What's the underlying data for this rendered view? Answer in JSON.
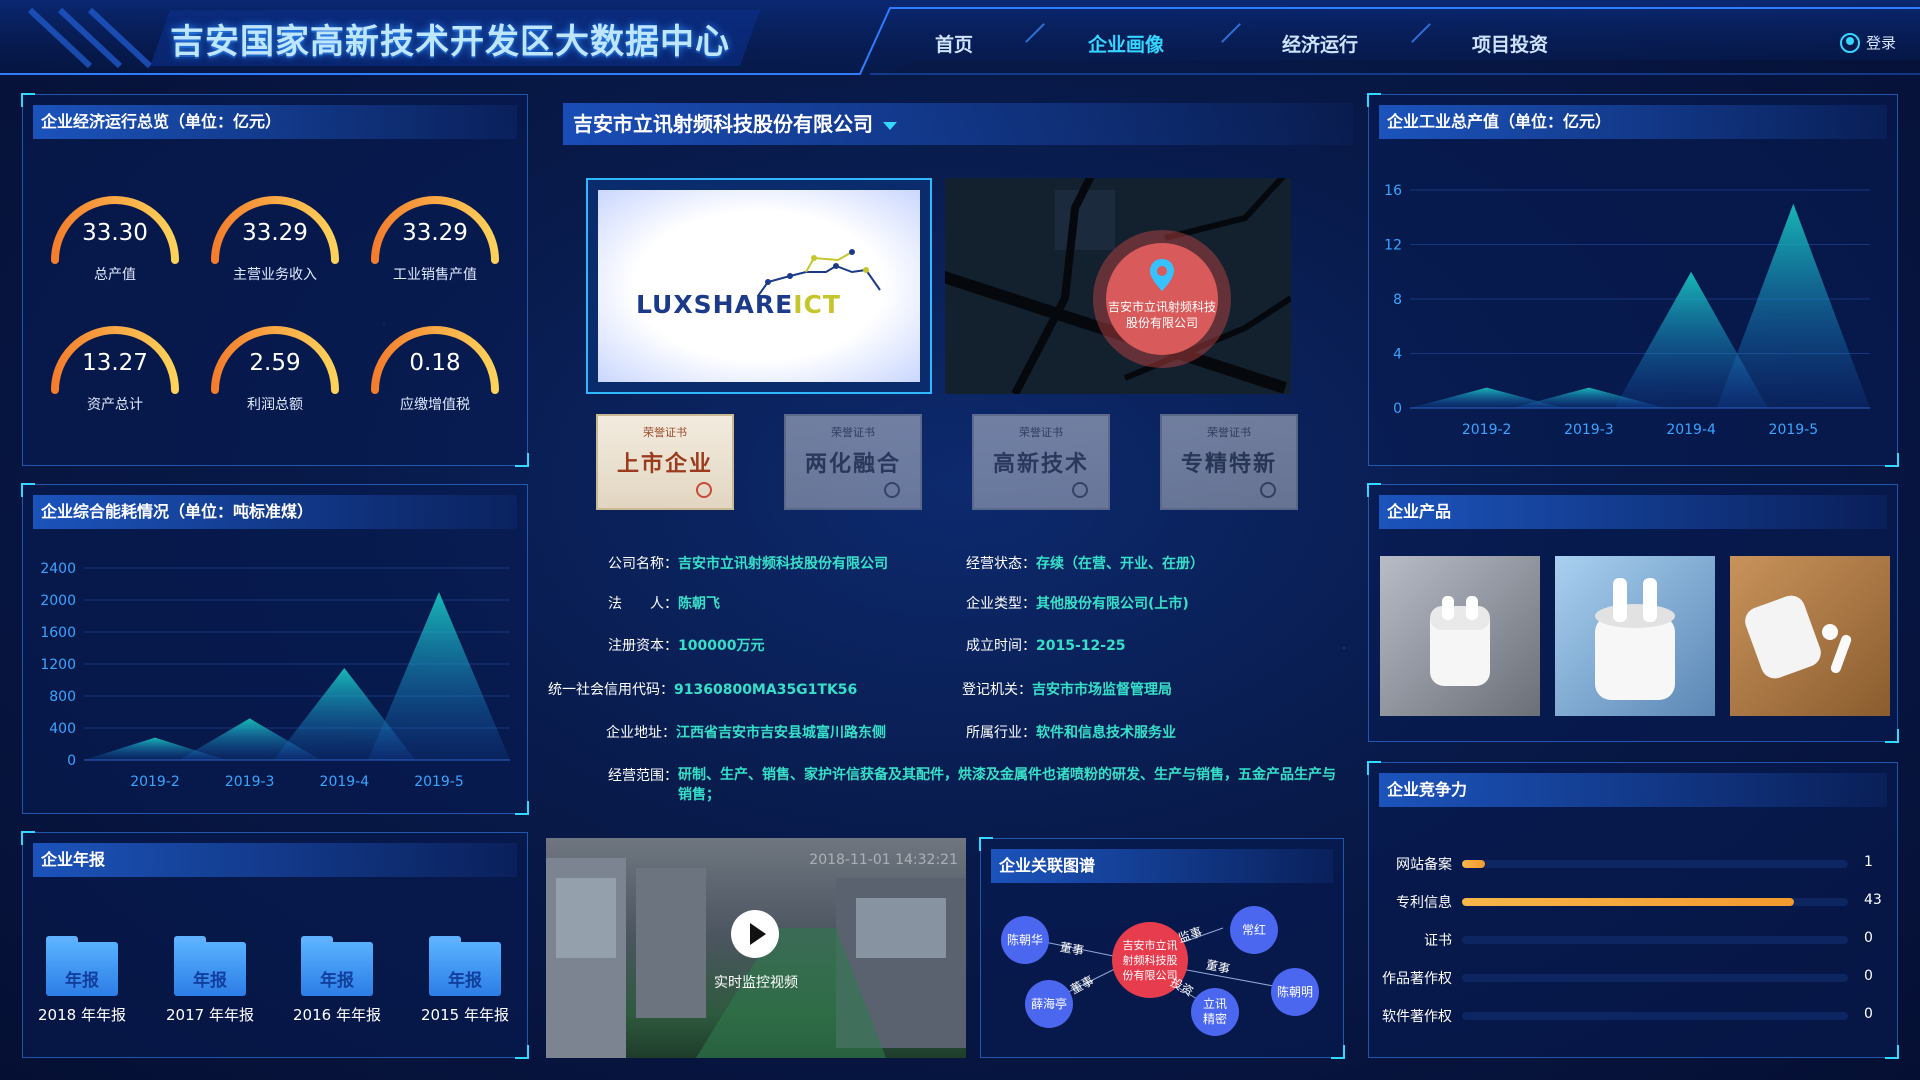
{
  "header": {
    "title": "吉安国家高新技术开发区大数据中心",
    "nav": [
      {
        "label": "首页",
        "active": false
      },
      {
        "label": "企业画像",
        "active": true
      },
      {
        "label": "经济运行",
        "active": false
      },
      {
        "label": "项目投资",
        "active": false
      }
    ],
    "login_label": "登录"
  },
  "overview": {
    "title": "企业经济运行总览（单位：亿元）",
    "gauges": [
      {
        "value": "33.30",
        "label": "总产值"
      },
      {
        "value": "33.29",
        "label": "主营业务收入"
      },
      {
        "value": "33.29",
        "label": "工业销售产值"
      },
      {
        "value": "13.27",
        "label": "资产总计"
      },
      {
        "value": "2.59",
        "label": "利润总额"
      },
      {
        "value": "0.18",
        "label": "应缴增值税"
      }
    ]
  },
  "energy": {
    "title": "企业综合能耗情况（单位：吨标准煤）"
  },
  "annual": {
    "title": "企业年报",
    "folder_label": "年报",
    "items": [
      "2018 年年报",
      "2017 年年报",
      "2016 年年报",
      "2015 年年报"
    ]
  },
  "company": {
    "selected": "吉安市立讯射频科技股份有限公司",
    "logo_text_a": "LUXSHARE",
    "logo_text_b": "ICT",
    "map_label": "吉安市立讯射频科技股份有限公司",
    "certs": [
      {
        "top": "荣誉证书",
        "name": "上市企业",
        "active": true
      },
      {
        "top": "荣誉证书",
        "name": "两化融合",
        "active": false
      },
      {
        "top": "荣誉证书",
        "name": "高新技术",
        "active": false
      },
      {
        "top": "荣誉证书",
        "name": "专精特新",
        "active": false
      }
    ],
    "info": {
      "name_label": "公司名称：",
      "name": "吉安市立讯射频科技股份有限公司",
      "status_label": "经营状态：",
      "status": "存续（在营、开业、在册）",
      "legal_label": "法　　人：",
      "legal": "陈朝飞",
      "type_label": "企业类型：",
      "type": "其他股份有限公司(上市)",
      "capital_label": "注册资本：",
      "capital": "100000万元",
      "founded_label": "成立时间：",
      "founded": "2015-12-25",
      "credit_label": "统一社会信用代码：",
      "credit": "91360800MA35G1TK56",
      "authority_label": "登记机关：",
      "authority": "吉安市市场监督管理局",
      "address_label": "企业地址：",
      "address": "江西省吉安市吉安县城富川路东侧",
      "industry_label": "所属行业：",
      "industry": "软件和信息技术服务业",
      "scope_label": "经营范围：",
      "scope": "研制、生产、销售、家护许信获备及其配件，烘漆及金属件也诸喷粉的研发、生产与销售，五金产品生产与销售；"
    }
  },
  "video": {
    "timestamp": "2018-11-01  14:32:21",
    "label": "实时监控视频"
  },
  "graph": {
    "title": "企业关联图谱",
    "center": "吉安市立讯射频科技股份有限公司",
    "nodes": [
      "陈朝华",
      "常红",
      "薛海亭",
      "陈朝明",
      "立讯精密"
    ],
    "edges": [
      "董事",
      "监事",
      "董事",
      "董事",
      "投资"
    ]
  },
  "output": {
    "title": "企业工业总产值（单位：亿元）"
  },
  "products": {
    "title": "企业产品",
    "items": [
      "airpods-product-1",
      "airpods-product-2",
      "airpods-product-3"
    ]
  },
  "competitiveness": {
    "title": "企业竞争力",
    "rows": [
      {
        "label": "网站备案",
        "value": 1
      },
      {
        "label": "专利信息",
        "value": 43
      },
      {
        "label": "证书",
        "value": 0
      },
      {
        "label": "作品著作权",
        "value": 0
      },
      {
        "label": "软件著作权",
        "value": 0
      }
    ]
  },
  "chart_data": [
    {
      "type": "area",
      "title": "企业综合能耗情况（单位：吨标准煤）",
      "categories": [
        "2019-2",
        "2019-3",
        "2019-4",
        "2019-5"
      ],
      "values": [
        280,
        520,
        1150,
        2100
      ],
      "ylim": [
        0,
        2400
      ],
      "yticks": [
        0,
        400,
        800,
        1200,
        1600,
        2000,
        2400
      ]
    },
    {
      "type": "area",
      "title": "企业工业总产值（单位：亿元）",
      "categories": [
        "2019-2",
        "2019-3",
        "2019-4",
        "2019-5"
      ],
      "values": [
        1.5,
        1.5,
        10,
        15
      ],
      "ylim": [
        0,
        16
      ],
      "yticks": [
        0,
        4,
        8,
        12,
        16
      ]
    }
  ]
}
